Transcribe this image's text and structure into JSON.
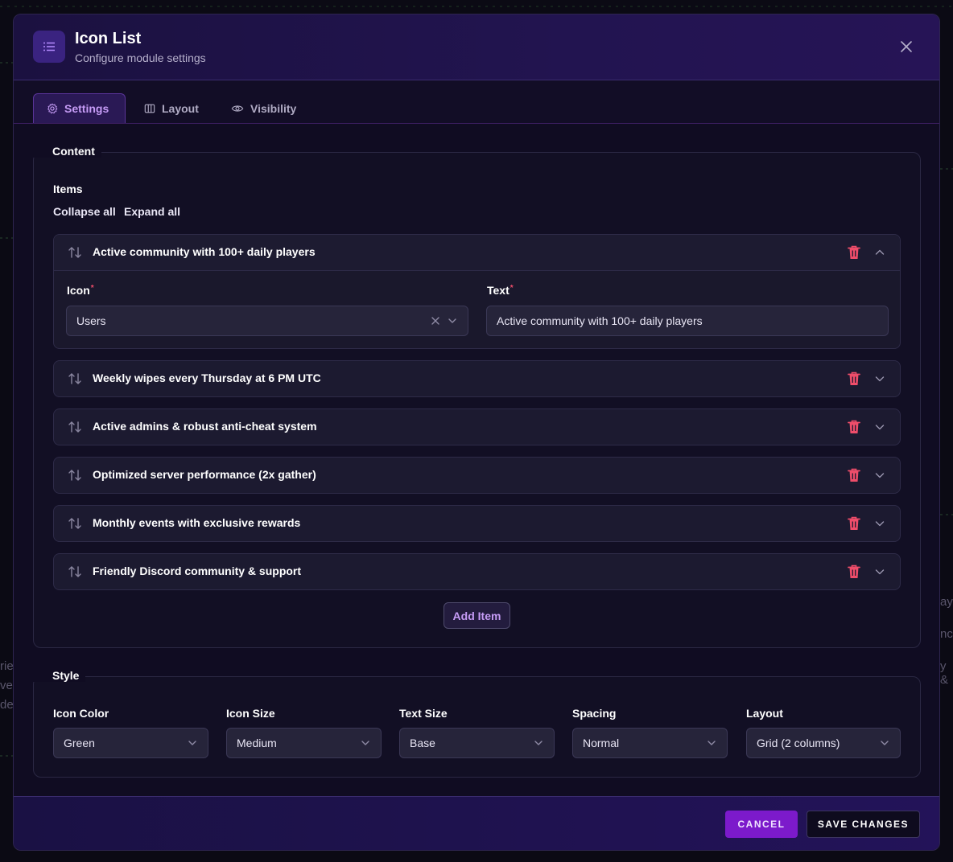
{
  "background": {
    "fragments": [
      "ay",
      "nce",
      "y &",
      "rie",
      "ve",
      "de"
    ]
  },
  "header": {
    "title": "Icon List",
    "subtitle": "Configure module settings",
    "icon": "list-icon"
  },
  "tabs": [
    {
      "label": "Settings",
      "icon": "gear-icon",
      "active": true
    },
    {
      "label": "Layout",
      "icon": "columns-icon",
      "active": false
    },
    {
      "label": "Visibility",
      "icon": "eye-icon",
      "active": false
    }
  ],
  "content": {
    "legend": "Content",
    "items_label": "Items",
    "collapse_all": "Collapse all",
    "expand_all": "Expand all",
    "items": [
      {
        "title": "Active community with 100+ daily players"
      },
      {
        "title": "Weekly wipes every Thursday at 6 PM UTC"
      },
      {
        "title": "Active admins & robust anti-cheat system"
      },
      {
        "title": "Optimized server performance (2x gather)"
      },
      {
        "title": "Monthly events with exclusive rewards"
      },
      {
        "title": "Friendly Discord community & support"
      }
    ],
    "expanded": {
      "icon_label": "Icon",
      "icon_value": "Users",
      "text_label": "Text",
      "text_value": "Active community with 100+ daily players",
      "required_mark": "*"
    },
    "add_item": "Add Item"
  },
  "style": {
    "legend": "Style",
    "fields": [
      {
        "label": "Icon Color",
        "value": "Green"
      },
      {
        "label": "Icon Size",
        "value": "Medium"
      },
      {
        "label": "Text Size",
        "value": "Base"
      },
      {
        "label": "Spacing",
        "value": "Normal"
      },
      {
        "label": "Layout",
        "value": "Grid (2 columns)"
      }
    ]
  },
  "footer": {
    "cancel": "CANCEL",
    "save": "SAVE CHANGES"
  },
  "colors": {
    "accent": "#7c1acb",
    "accent_text": "#c69cf6",
    "danger": "#ef4d6a"
  }
}
